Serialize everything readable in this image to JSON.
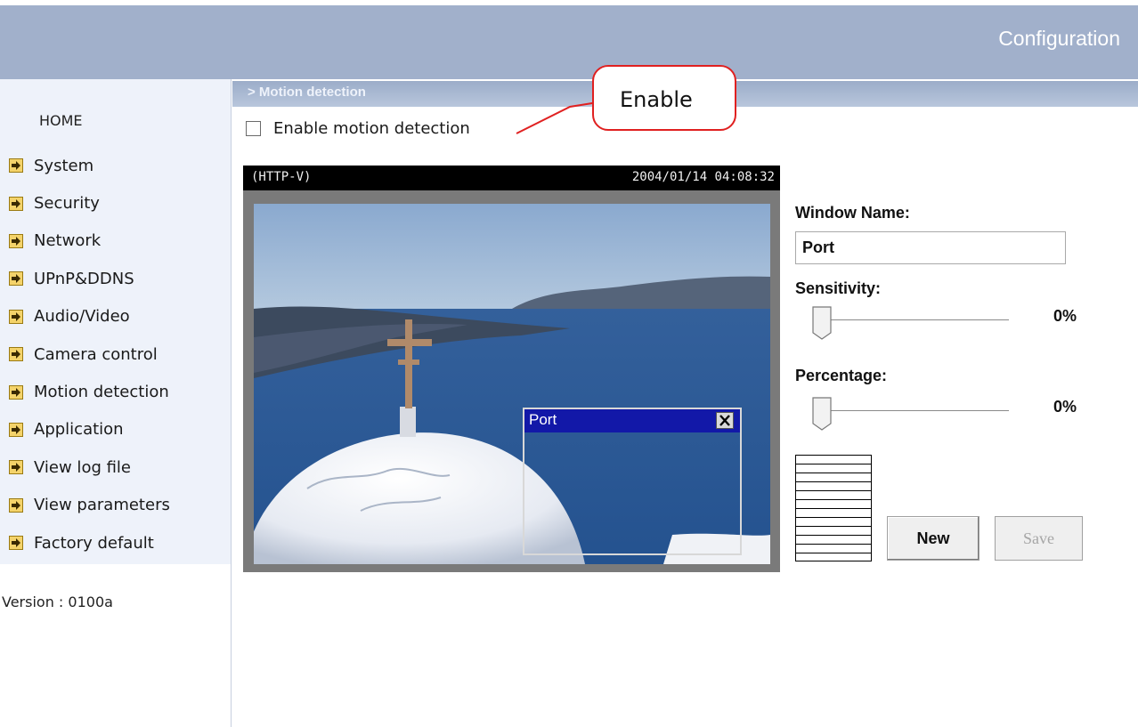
{
  "header": {
    "title": "Configuration"
  },
  "sidebar": {
    "home": "HOME",
    "items": [
      {
        "label": "System",
        "icon": "arrow-right-icon"
      },
      {
        "label": "Security",
        "icon": "arrow-right-icon"
      },
      {
        "label": "Network",
        "icon": "arrow-right-icon"
      },
      {
        "label": "UPnP&DDNS",
        "icon": "arrow-right-icon"
      },
      {
        "label": "Audio/Video",
        "icon": "arrow-right-icon"
      },
      {
        "label": "Camera control",
        "icon": "arrow-right-icon"
      },
      {
        "label": "Motion detection",
        "icon": "arrow-right-icon"
      },
      {
        "label": "Application",
        "icon": "arrow-right-icon"
      },
      {
        "label": "View log file",
        "icon": "arrow-right-icon"
      },
      {
        "label": "View parameters",
        "icon": "arrow-right-icon"
      },
      {
        "label": "Factory default",
        "icon": "arrow-right-icon"
      }
    ],
    "version": "Version : 0100a"
  },
  "section": {
    "title": "> Motion detection"
  },
  "enable": {
    "label": "Enable motion detection",
    "checked": false
  },
  "callout": {
    "text": "Enable"
  },
  "video": {
    "stream_label": "(HTTP-V)",
    "timestamp": "2004/01/14 04:08:32",
    "motion_window": {
      "title": "Port",
      "close_icon": "close-icon"
    }
  },
  "settings": {
    "window_name_label": "Window Name:",
    "window_name_value": "Port",
    "sensitivity_label": "Sensitivity:",
    "sensitivity_value": "0%",
    "sensitivity_level": 0,
    "percentage_label": "Percentage:",
    "percentage_value": "0%",
    "percentage_level": 0
  },
  "buttons": {
    "new": "New",
    "save": "Save"
  },
  "colors": {
    "header": "#a1b0cb",
    "sidebar": "#eef2fa",
    "section_bar": "#9cadc9",
    "callout_border": "#e02020",
    "window_titlebar": "#1218a8"
  }
}
